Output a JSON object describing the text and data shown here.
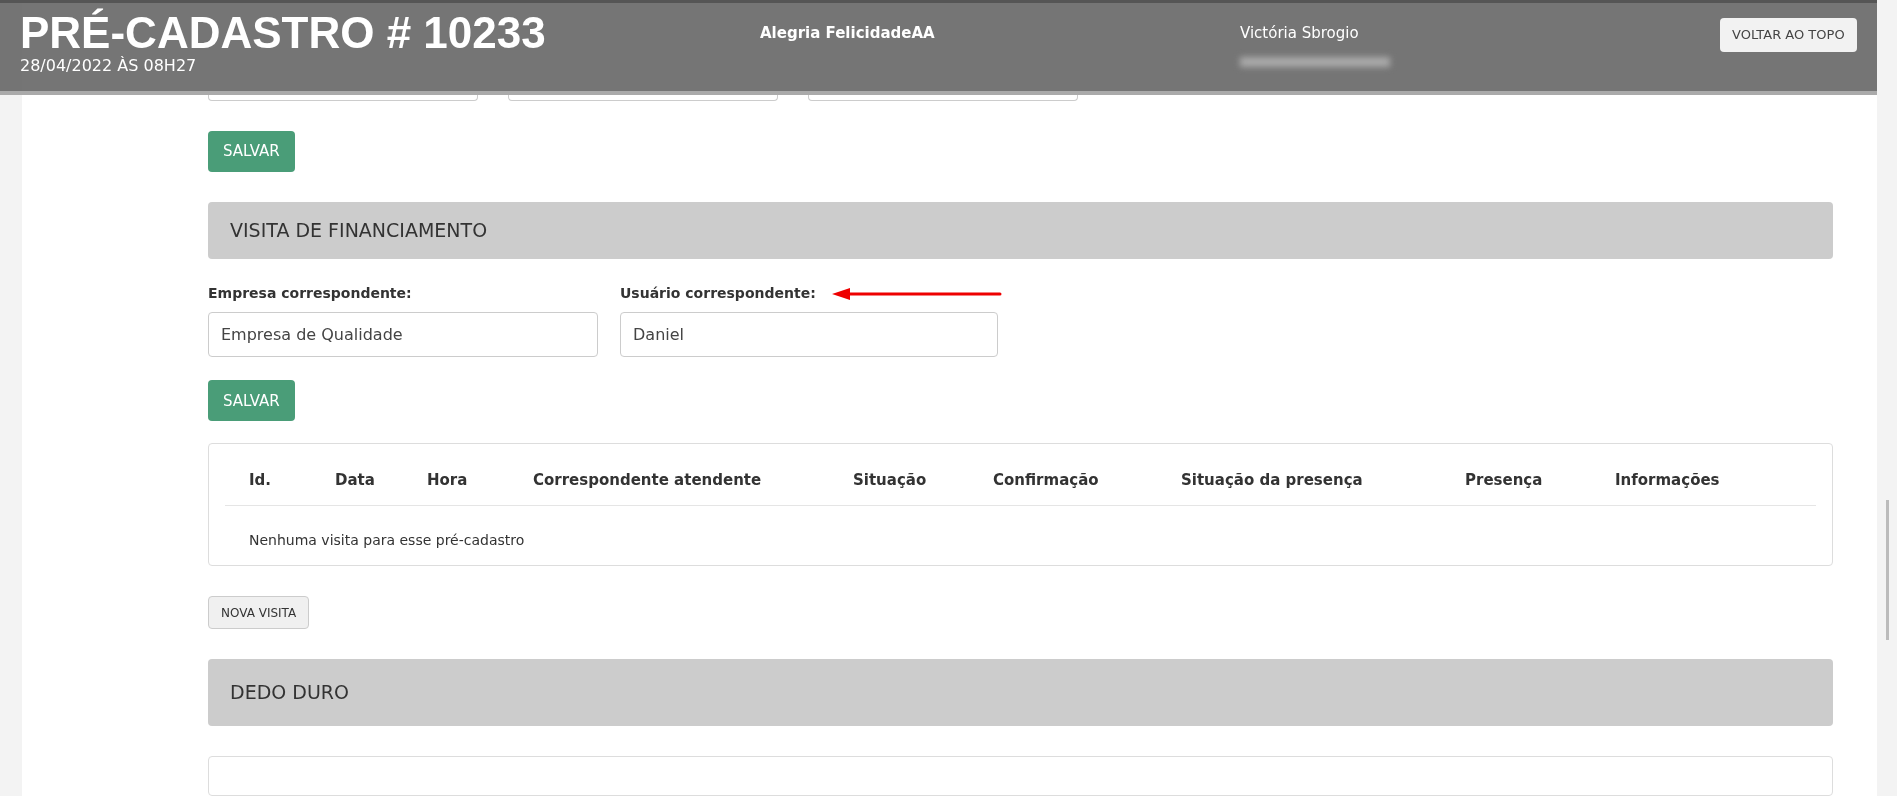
{
  "header": {
    "title": "PRÉ-CADASTRO # 10233",
    "subtitle": "28/04/2022 ÀS 08H27",
    "client": "Alegria FelicidadeAA",
    "user": "Victória Sbrogio",
    "top_button": "VOLTAR AO TOPO"
  },
  "first_save": "SALVAR",
  "financing": {
    "title": "VISITA DE FINANCIAMENTO",
    "fields": [
      {
        "label": "Empresa correspondente:",
        "value": "Empresa de Qualidade"
      },
      {
        "label": "Usuário correspondente:",
        "value": "Daniel"
      }
    ],
    "save": "SALVAR",
    "table": {
      "columns": [
        "Id.",
        "Data",
        "Hora",
        "Correspondente atendente",
        "Situação",
        "Confirmação",
        "Situação da presença",
        "Presença",
        "Informações"
      ],
      "empty": "Nenhuma visita para esse pré-cadastro"
    },
    "new_button": "NOVA VISITA"
  },
  "next_section": {
    "title": "DEDO DURO"
  }
}
